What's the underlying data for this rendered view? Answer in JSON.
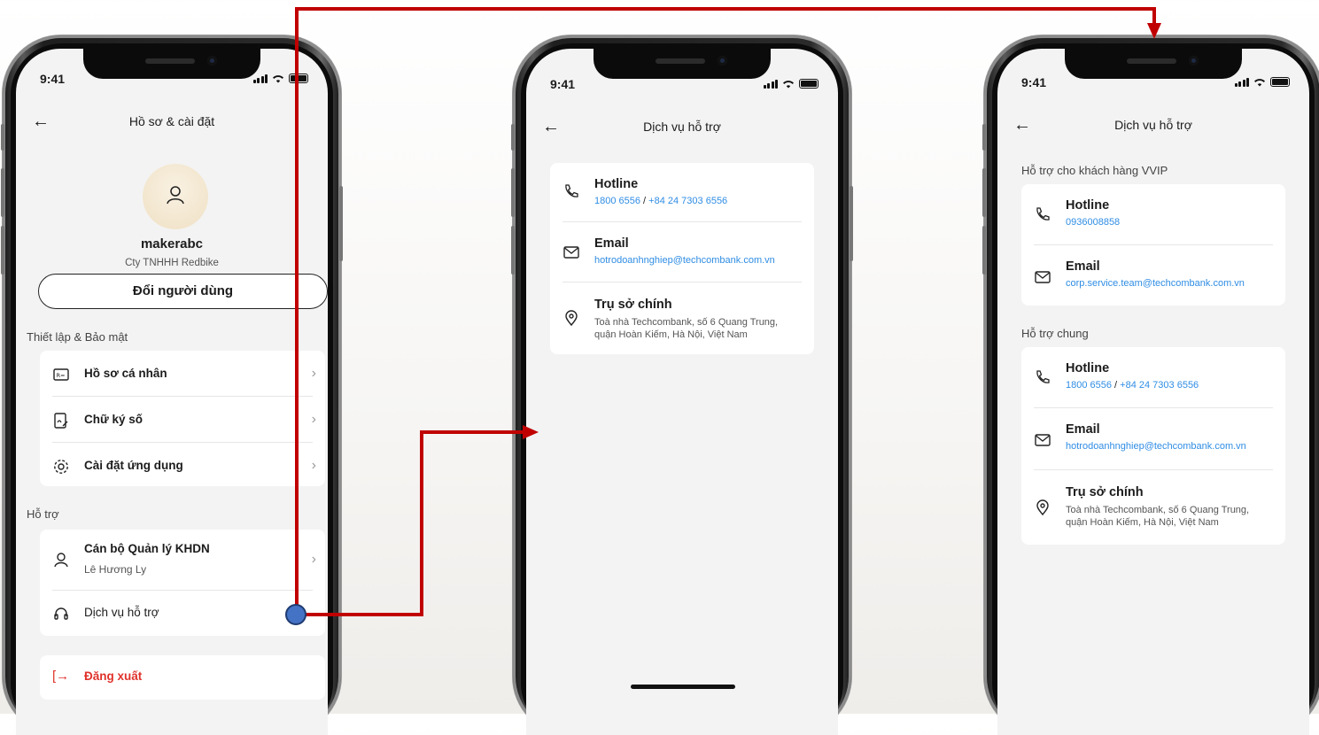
{
  "status_time": "9:41",
  "screen1": {
    "title": "Hồ sơ & cài đặt",
    "username": "makerabc",
    "company": "Cty TNHHH Redbike",
    "switch_user": "Đổi người dùng",
    "section_settings": "Thiết lập & Bảo mật",
    "settings_items": [
      "Hồ sơ cá nhân",
      "Chữ ký số",
      "Cài đặt ứng dụng"
    ],
    "section_support": "Hỗ trợ",
    "manager_title": "Cán bộ Quản lý KHDN",
    "manager_name": "Lê Hương Ly",
    "support_service": "Dịch vụ hỗ trợ",
    "logout": "Đăng xuất"
  },
  "screen2": {
    "title": "Dịch vụ hỗ trợ",
    "hotline_label": "Hotline",
    "hotline_1": "1800 6556",
    "hotline_sep": " / ",
    "hotline_2": "+84 24 7303 6556",
    "email_label": "Email",
    "email": "hotrodoanhnghiep@techcombank.com.vn",
    "hq_label": "Trụ sở chính",
    "hq_address_1": "Toà nhà Techcombank, số 6 Quang Trung,",
    "hq_address_2": "quận Hoàn Kiếm, Hà Nội, Việt Nam"
  },
  "screen3": {
    "title": "Dịch vụ hỗ trợ",
    "section_vvip": "Hỗ trợ cho khách hàng VVIP",
    "vvip_hotline_label": "Hotline",
    "vvip_hotline": "0936008858",
    "vvip_email_label": "Email",
    "vvip_email": "corp.service.team@techcombank.com.vn",
    "section_general": "Hỗ trợ chung",
    "hotline_label": "Hotline",
    "hotline_1": "1800 6556",
    "hotline_sep": " / ",
    "hotline_2": "+84 24 7303 6556",
    "email_label": "Email",
    "email": "hotrodoanhnghiep@techcombank.com.vn",
    "hq_label": "Trụ sở chính",
    "hq_address_1": "Toà nhà Techcombank, số 6 Quang Trung,",
    "hq_address_2": "quận Hoàn Kiếm, Hà Nội, Việt Nam"
  },
  "colors": {
    "link": "#2f8de4",
    "logout": "#e0322b",
    "flow_line": "#c00000",
    "flow_dot": "#4472c4"
  }
}
